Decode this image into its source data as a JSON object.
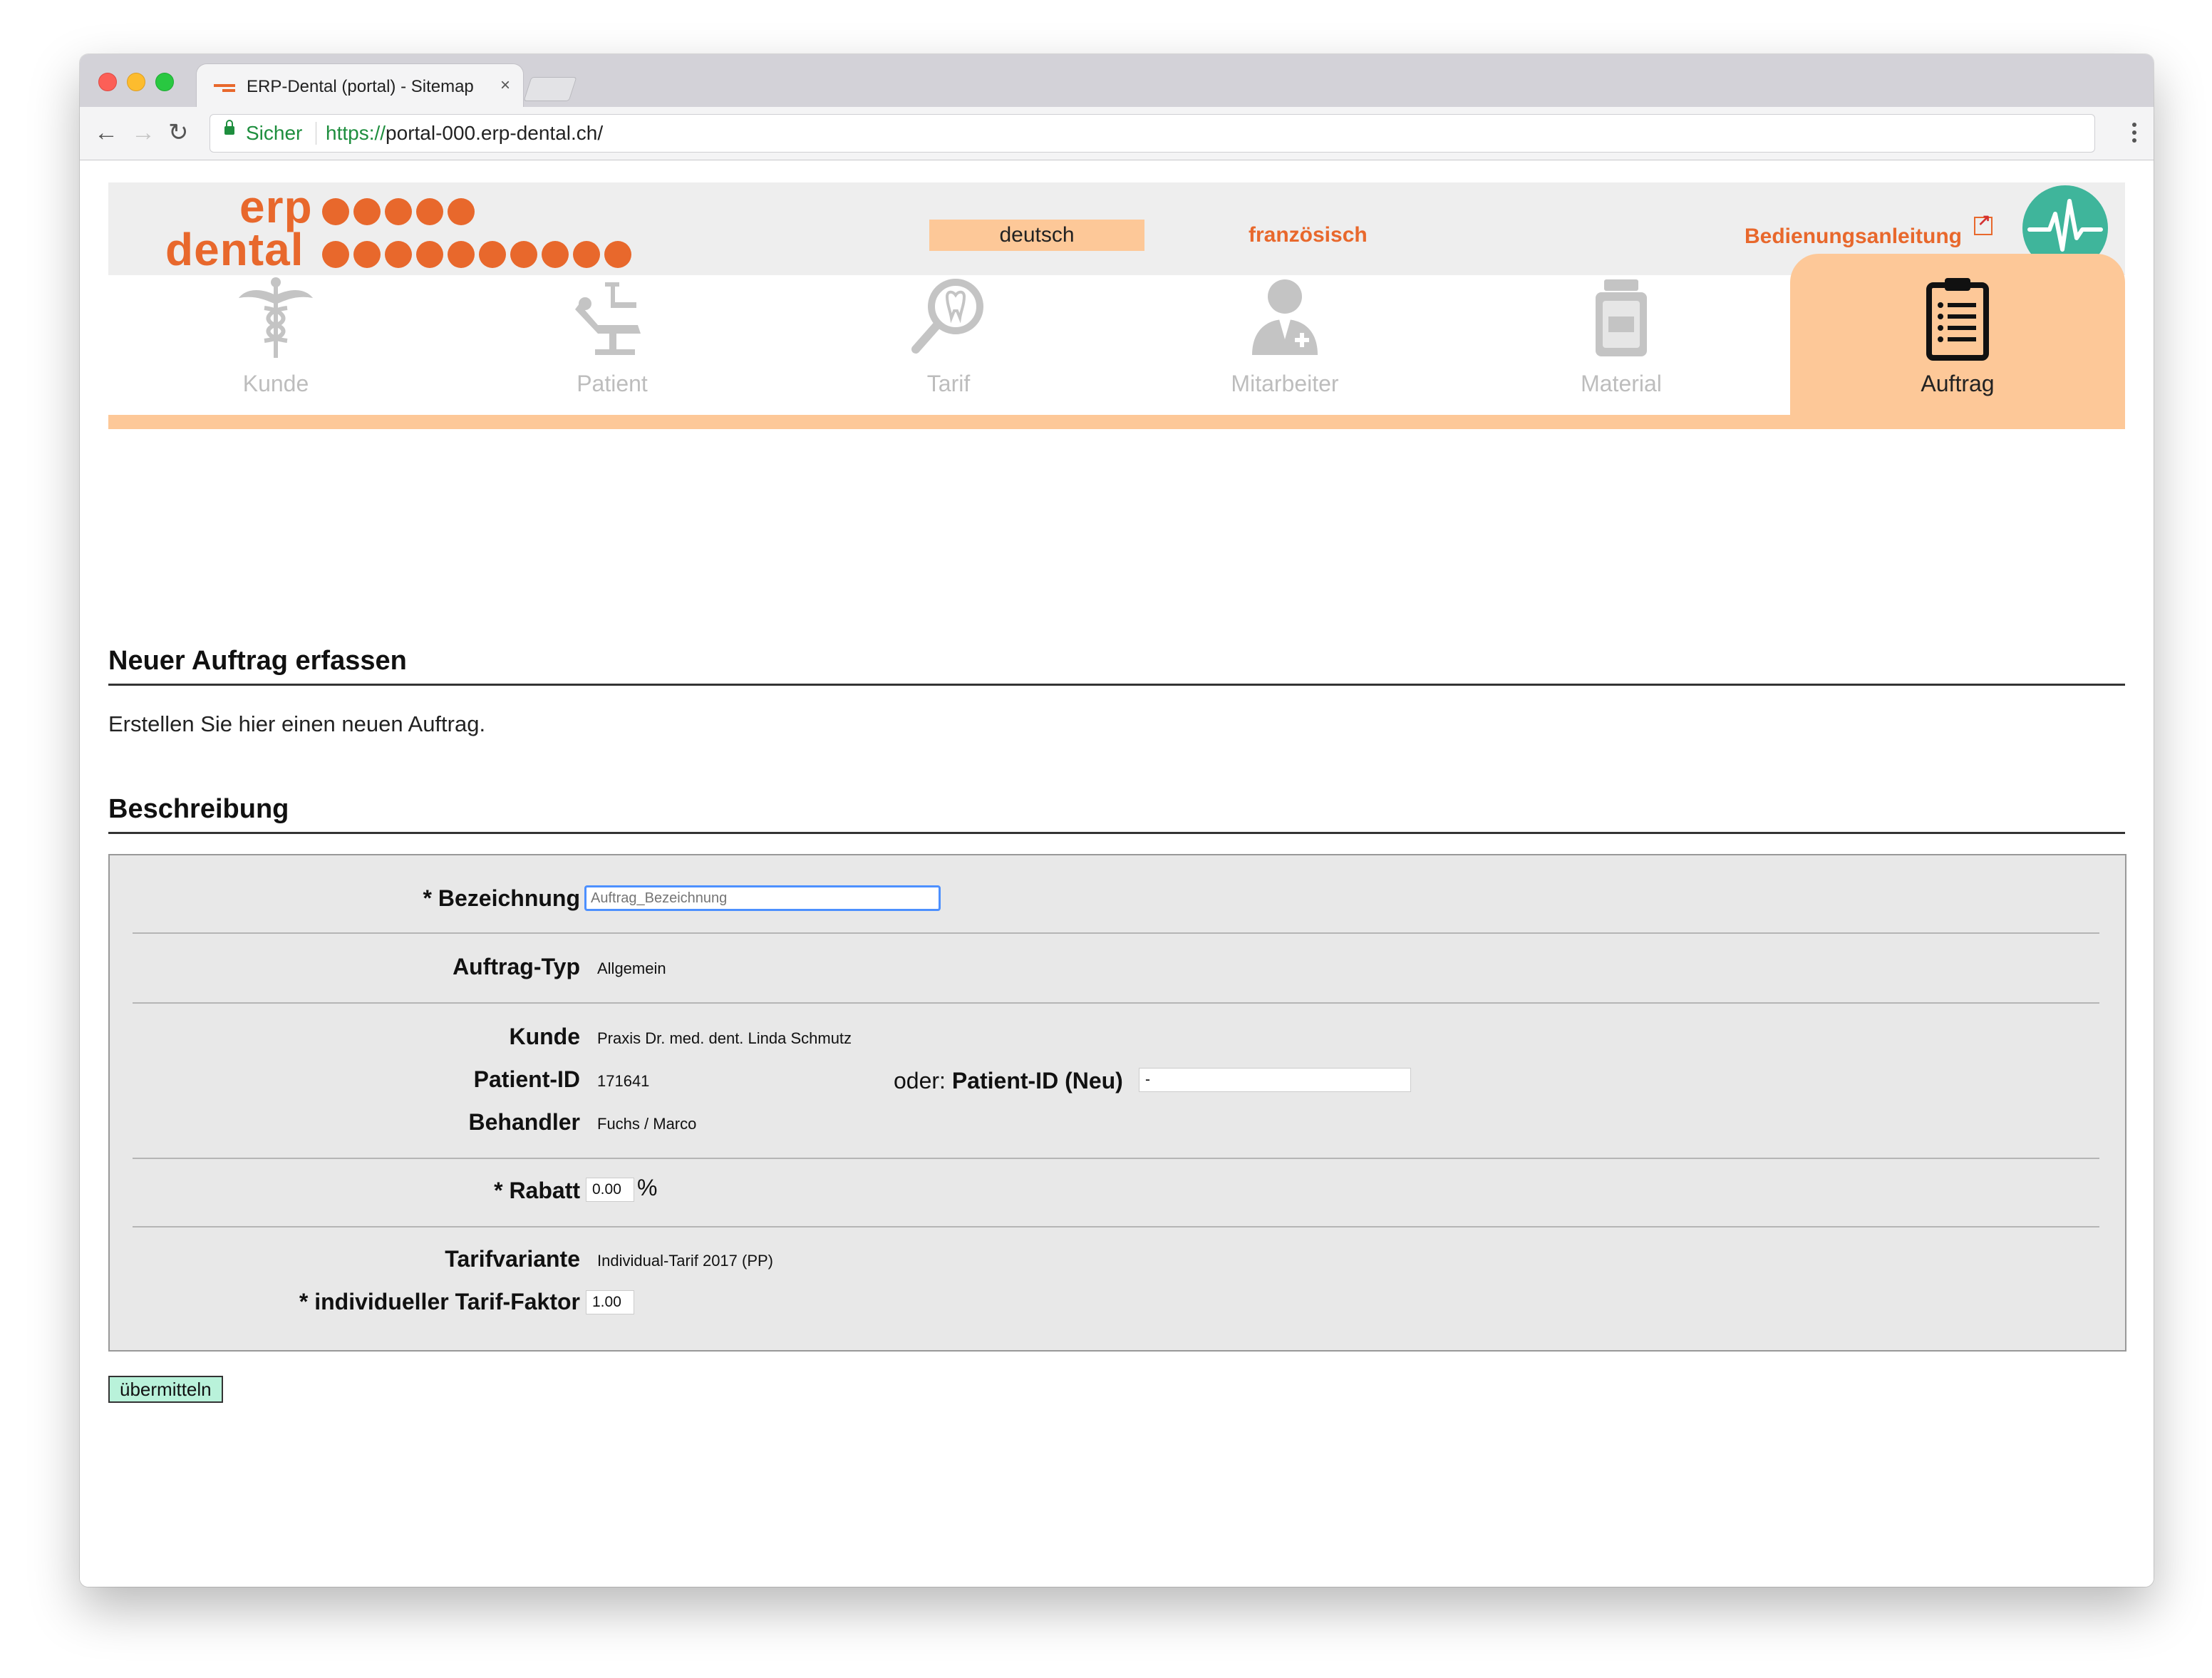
{
  "browser": {
    "tab_title": "ERP-Dental (portal) - Sitemap",
    "tab_close": "×",
    "secure_label": "Sicher",
    "url_scheme": "https://",
    "url_rest": "portal-000.erp-dental.ch/"
  },
  "header": {
    "logo_top": "erp",
    "logo_bottom": "dental",
    "lang_active": "deutsch",
    "lang_other": "französisch",
    "manual_link": "Bedienungsanleitung"
  },
  "nav": {
    "items": [
      {
        "label": "Kunde",
        "icon": "caduceus-icon"
      },
      {
        "label": "Patient",
        "icon": "dental-chair-icon"
      },
      {
        "label": "Tarif",
        "icon": "tooth-magnifier-icon"
      },
      {
        "label": "Mitarbeiter",
        "icon": "staff-icon"
      },
      {
        "label": "Material",
        "icon": "material-jar-icon"
      },
      {
        "label": "Auftrag",
        "icon": "clipboard-icon"
      }
    ],
    "active": "Auftrag"
  },
  "content": {
    "title": "Neuer Auftrag erfassen",
    "intro": "Erstellen Sie hier einen neuen Auftrag.",
    "section_title": "Beschreibung"
  },
  "form": {
    "bezeichnung_label": "* Bezeichnung",
    "bezeichnung_placeholder": "Auftrag_Bezeichnung",
    "auftrag_typ_label": "Auftrag-Typ",
    "auftrag_typ_value": "Allgemein",
    "kunde_label": "Kunde",
    "kunde_value": "Praxis Dr. med. dent. Linda Schmutz",
    "patient_id_label": "Patient-ID",
    "patient_id_value": "171641",
    "oder_text": "oder:",
    "patient_id_new_label": "Patient-ID (Neu)",
    "patient_id_new_value": "-",
    "behandler_label": "Behandler",
    "behandler_value": "Fuchs / Marco",
    "rabatt_label": "* Rabatt",
    "rabatt_value": "0.00",
    "rabatt_unit": "%",
    "tarifvariante_label": "Tarifvariante",
    "tarifvariante_value": "Individual-Tarif 2017 (PP)",
    "tariffaktor_label": "* individueller Tarif-Faktor",
    "tariffaktor_value": "1.00",
    "submit_label": "übermitteln"
  },
  "colors": {
    "brand_orange": "#e8682c",
    "nav_peach": "#fdc898",
    "submit_green": "#b9f2da",
    "pulse_teal": "#3fb59b"
  }
}
